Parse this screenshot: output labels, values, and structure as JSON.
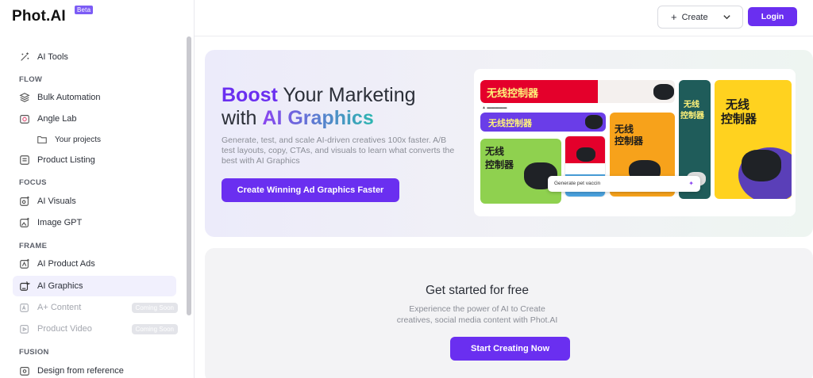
{
  "brand": {
    "name": "Phot.AI",
    "badge": "Beta"
  },
  "header": {
    "create_label": "Create",
    "login_label": "Login"
  },
  "sidebar": {
    "ai_tools": "AI Tools",
    "sections": {
      "flow": "FLOW",
      "focus": "FOCUS",
      "frame": "FRAME",
      "fusion": "FUSION"
    },
    "items": {
      "bulk_automation": "Bulk Automation",
      "angle_lab": "Angle Lab",
      "your_projects": "Your projects",
      "product_listing": "Product Listing",
      "ai_visuals": "AI Visuals",
      "image_gpt": "Image GPT",
      "ai_product_ads": "AI Product Ads",
      "ai_graphics": "AI Graphics",
      "a_plus_content": "A+ Content",
      "product_video": "Product Video",
      "design_from_reference": "Design from reference"
    },
    "coming_soon": "Coming Soon"
  },
  "hero": {
    "title_boost": "Boost",
    "title_rest": " Your Marketing",
    "title_with": "with ",
    "title_graphics": "AI Graphics",
    "subtitle": "Generate, test, and scale AI-driven creatives 100x faster. A/B test layouts, copy, CTAs, and visuals to learn what converts the best with AI Graphics",
    "cta": "Create Winning Ad Graphics Faster",
    "collage": {
      "prompt": "Generate pet vaccin",
      "headline_line1": "无线",
      "headline_line2": "控制器",
      "headline_full": "无线控制器"
    }
  },
  "started": {
    "title": "Get started for free",
    "subtitle_line1": "Experience the power of AI to Create",
    "subtitle_line2": "creatives, social media content with Phot.AI",
    "cta": "Start Creating Now"
  },
  "colors": {
    "accent": "#6a2ff0",
    "gradient_start": "#8a44f0",
    "gradient_end": "#2cb7b0"
  }
}
